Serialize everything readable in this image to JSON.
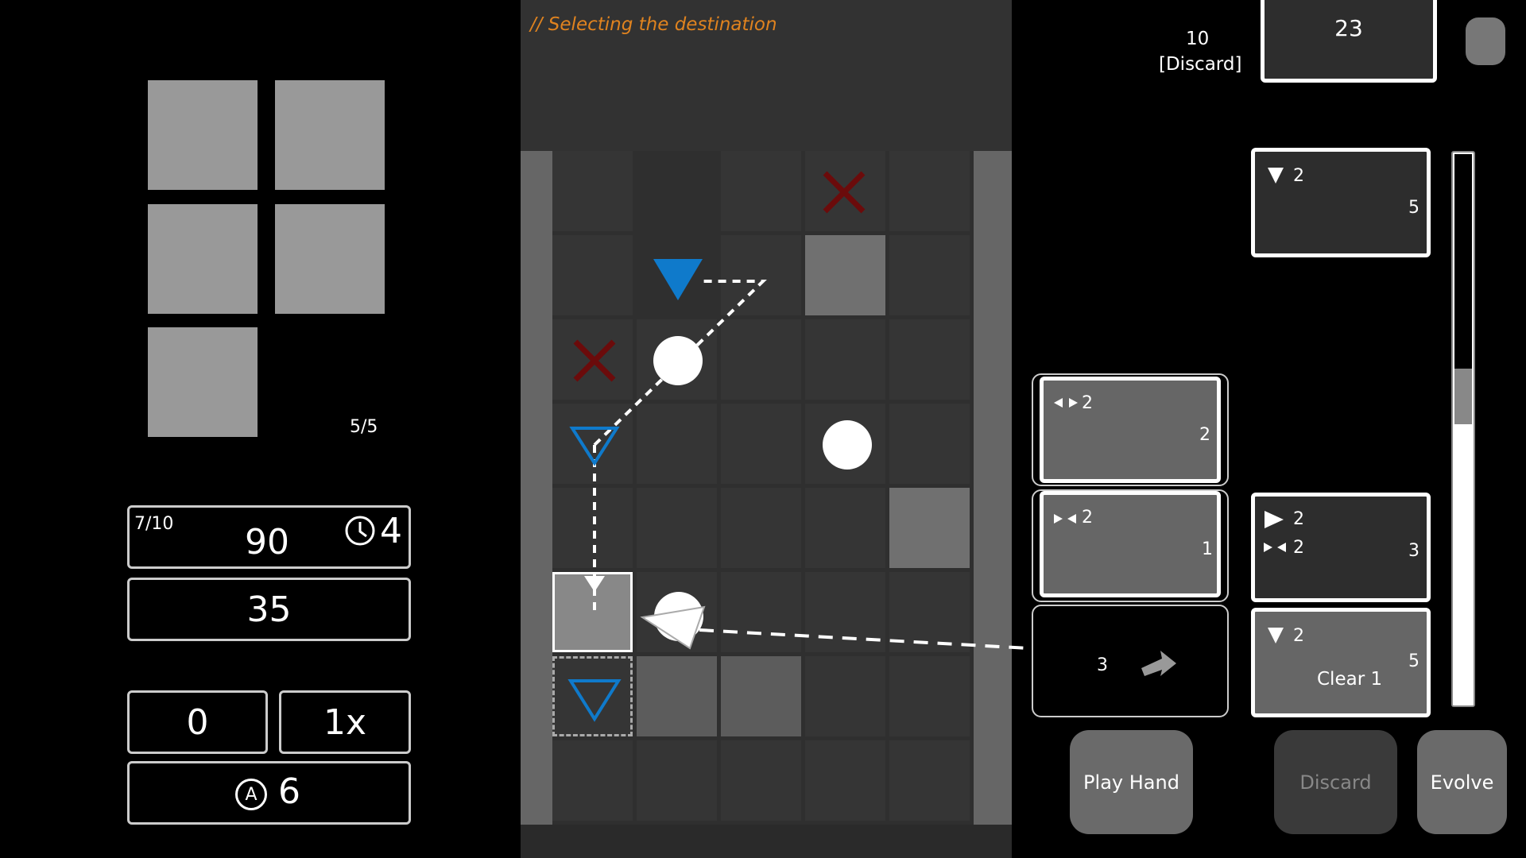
{
  "left": {
    "deck_count": "5/5",
    "stats": {
      "turn": "7/10",
      "score": "90",
      "time": "4",
      "target": "35",
      "left_value": "0",
      "multiplier": "1x",
      "actions": "6",
      "actions_icon_letter": "A"
    }
  },
  "board": {
    "hint": "// Selecting the destination"
  },
  "top_right": {
    "discard_count": "10",
    "discard_label": "[Discard]",
    "deck_value": "23"
  },
  "hand": [
    {
      "label": "2",
      "value": "2"
    },
    {
      "label": "2",
      "value": "1"
    },
    {
      "value": "3"
    }
  ],
  "side_cards": [
    {
      "label": "2",
      "value": "5"
    },
    {
      "label1": "2",
      "label2": "2",
      "value": "3"
    },
    {
      "label": "2",
      "value": "5",
      "text": "Clear 1"
    }
  ],
  "buttons": {
    "play": "Play Hand",
    "discard": "Discard",
    "evolve": "Evolve"
  },
  "colors": {
    "blue": "#0f7acb",
    "red": "#6b0b0b",
    "hint": "#e0831f"
  },
  "progress": {
    "scroll_fraction": 0.3
  }
}
